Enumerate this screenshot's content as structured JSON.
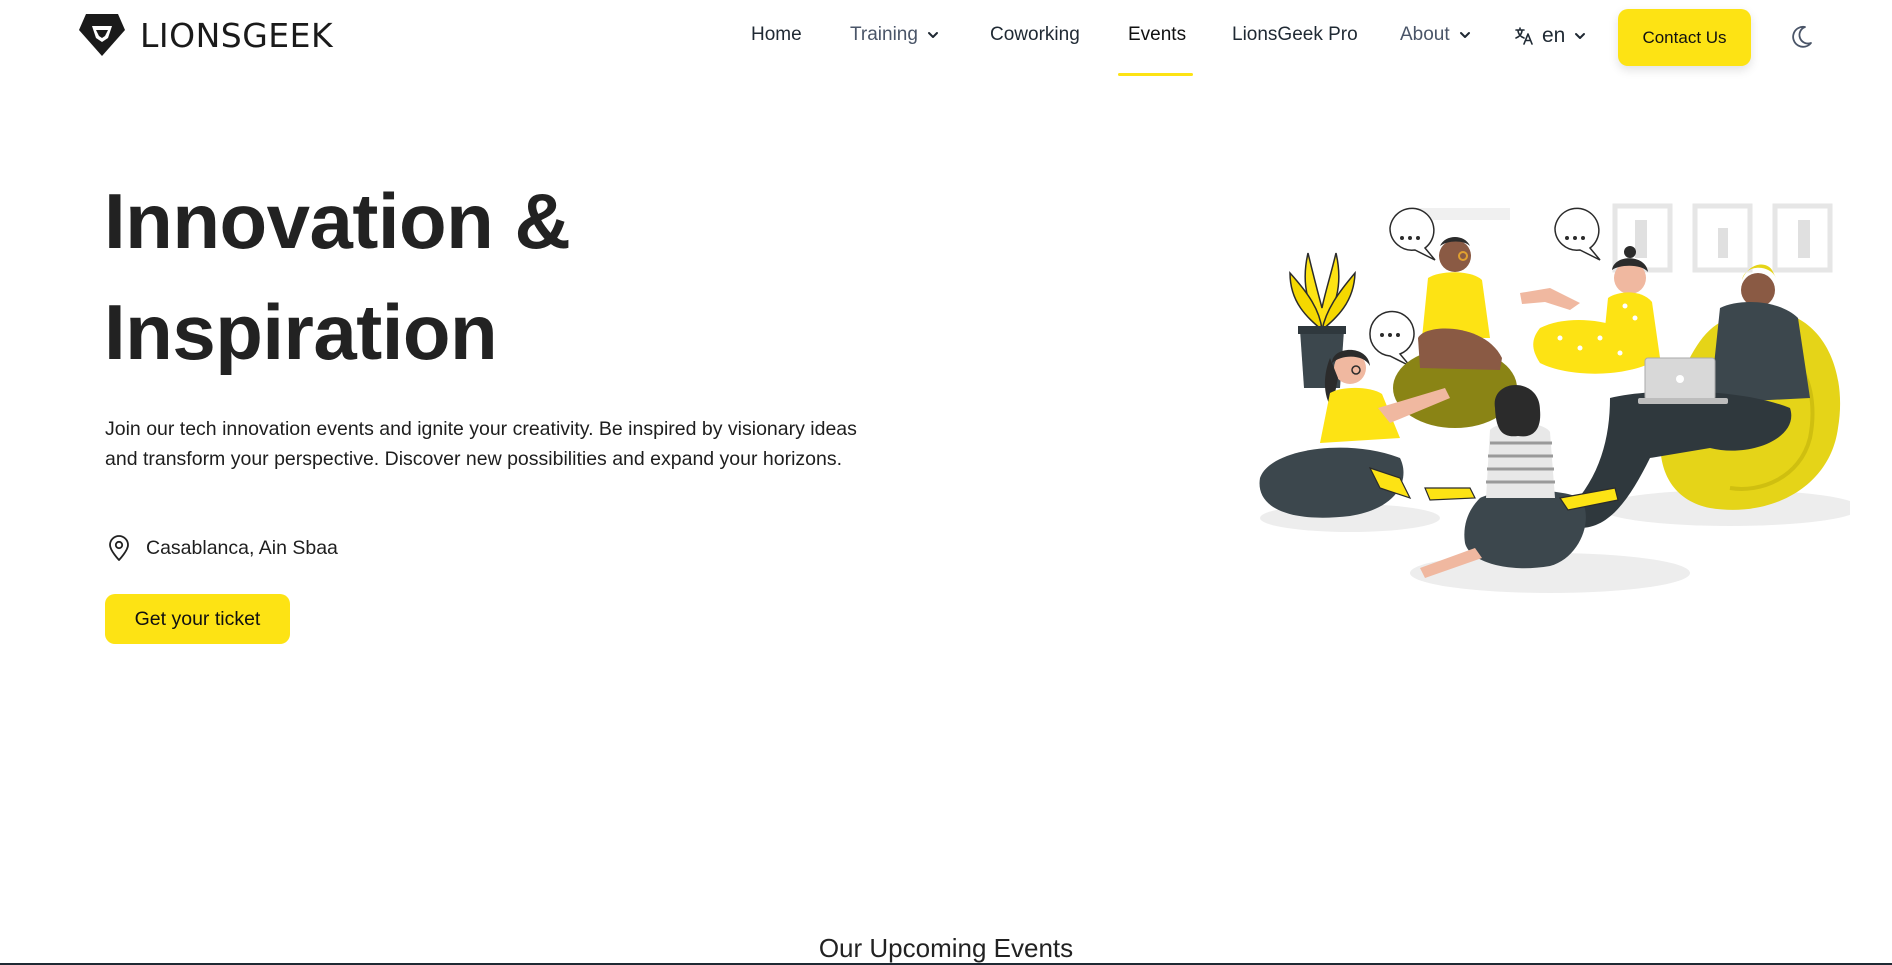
{
  "brand": {
    "name": "LIONSGEEK"
  },
  "nav": {
    "home": "Home",
    "training": "Training",
    "coworking": "Coworking",
    "events": "Events",
    "pro": "LionsGeek Pro",
    "about": "About",
    "language": "en",
    "contact": "Contact Us"
  },
  "hero": {
    "title_line1": "Innovation &",
    "title_line2": "Inspiration",
    "description": "Join our tech innovation events and ignite your creativity. Be inspired by visionary ideas and transform your perspective. Discover new possibilities and expand your horizons.",
    "location": "Casablanca, Ain Sbaa",
    "cta": "Get your ticket"
  },
  "sections": {
    "upcoming_title": "Our Upcoming Events"
  },
  "colors": {
    "accent": "#fde314",
    "text": "#1f1f1f",
    "muted": "#4a5568",
    "illustration_dark": "#3c474d"
  },
  "icons": {
    "logo": "lion-shield-icon",
    "language": "translate-icon",
    "theme": "moon-icon",
    "location": "map-pin-icon",
    "dropdown": "chevron-down-icon"
  }
}
